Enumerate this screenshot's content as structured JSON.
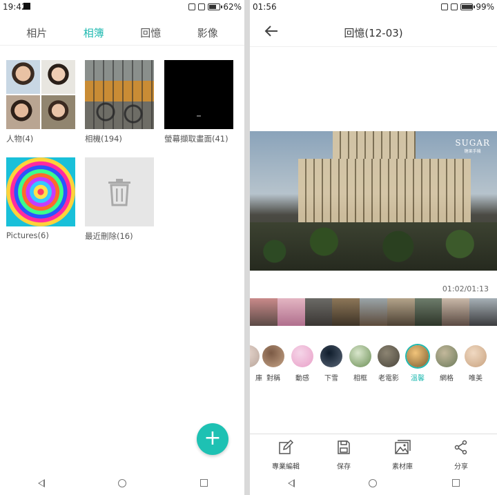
{
  "left": {
    "status": {
      "time": "19:42",
      "battery": "62%"
    },
    "tabs": [
      {
        "label": "相片",
        "active": false
      },
      {
        "label": "相簿",
        "active": true
      },
      {
        "label": "回憶",
        "active": false
      },
      {
        "label": "影像",
        "active": false
      }
    ],
    "albums": [
      {
        "label": "人物(4)"
      },
      {
        "label": "相機(194)"
      },
      {
        "label": "螢幕擷取畫面(41)"
      },
      {
        "label": "Pictures(6)"
      },
      {
        "label": "最近刪除(16)"
      }
    ],
    "fab_label": "+",
    "accent": "#1eb9b0"
  },
  "right": {
    "status": {
      "time": "01:56",
      "battery": "99%"
    },
    "title": "回憶(12-03)",
    "watermark": {
      "brand": "SUGAR",
      "sub": "糖果手機"
    },
    "timecode": "01:02/01:13",
    "filters": [
      {
        "label": "庫",
        "colors": [
          "#e8d7cf",
          "#b8a59a"
        ]
      },
      {
        "label": "對稱",
        "colors": [
          "#7b5a45",
          "#c5a386"
        ]
      },
      {
        "label": "動感",
        "colors": [
          "#f5d5e8",
          "#e9a0c8"
        ]
      },
      {
        "label": "下雪",
        "colors": [
          "#0f1c2b",
          "#5a6778"
        ]
      },
      {
        "label": "相框",
        "colors": [
          "#d9e6cc",
          "#6b8f55"
        ]
      },
      {
        "label": "老電影",
        "colors": [
          "#8c8472",
          "#4a463c"
        ]
      },
      {
        "label": "溫馨",
        "colors": [
          "#f2c47a",
          "#7a5b2f"
        ],
        "selected": true
      },
      {
        "label": "網格",
        "colors": [
          "#c3b89b",
          "#6b7a5a"
        ]
      },
      {
        "label": "唯美",
        "colors": [
          "#f0d9c2",
          "#c8a27f"
        ]
      }
    ],
    "tools": [
      {
        "label": "專業編輯",
        "icon": "edit-icon"
      },
      {
        "label": "保存",
        "icon": "save-icon"
      },
      {
        "label": "素材庫",
        "icon": "gallery-icon"
      },
      {
        "label": "分享",
        "icon": "share-icon"
      }
    ]
  }
}
